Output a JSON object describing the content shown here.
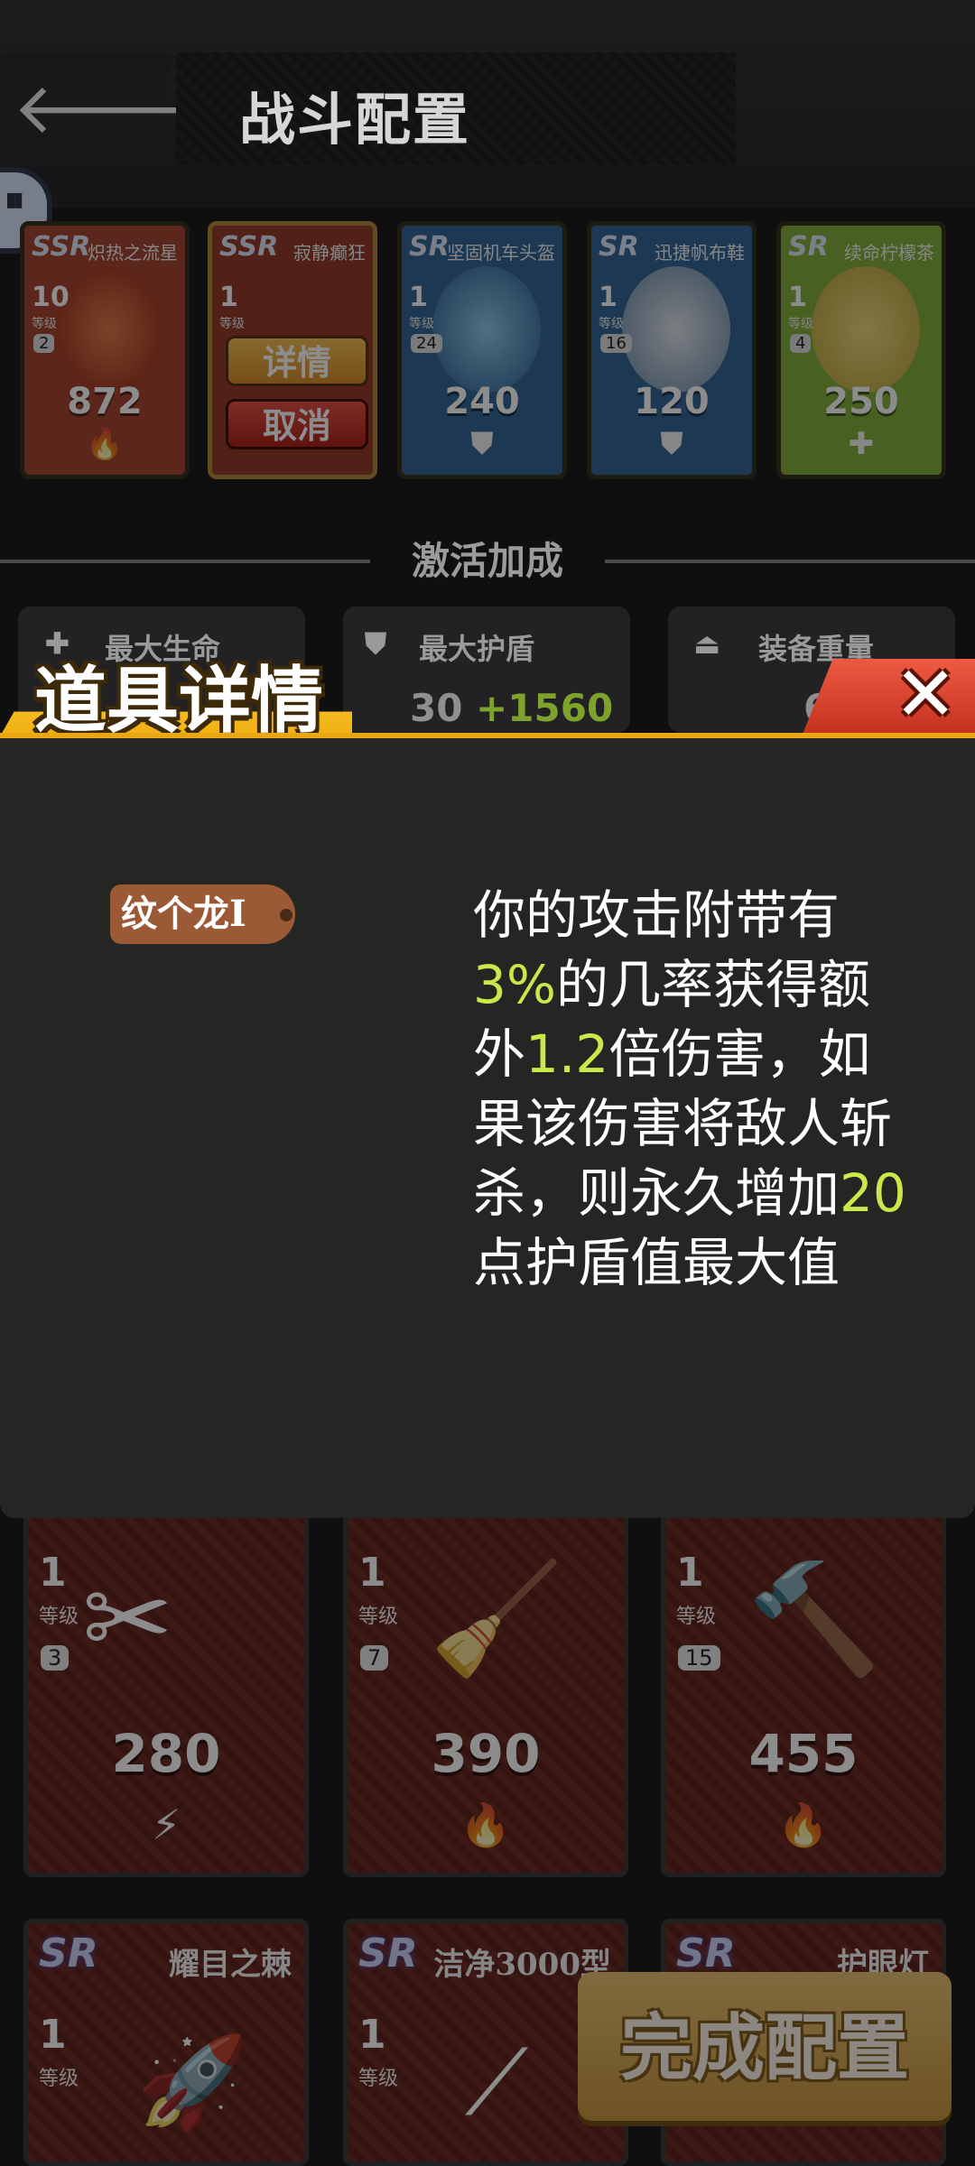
{
  "header": {
    "title": "战斗配置",
    "back_icon": "arrow-left-icon",
    "chat_icon": "chat-bubble-icon"
  },
  "equipped_cards": [
    {
      "rarity": "SSR",
      "name": "炽热之流星",
      "level": "10",
      "level_caption": "等级",
      "cost": "2",
      "power": "872",
      "badge_icon": "flame-icon",
      "color": "#c2432a"
    },
    {
      "rarity": "SSR",
      "name": "寂静癫狂",
      "level": "1",
      "level_caption": "等级",
      "cost": "",
      "power": "",
      "badge_icon": "",
      "color": "#b23a24"
    },
    {
      "rarity": "SR",
      "name": "坚固机车头盔",
      "level": "1",
      "level_caption": "等级",
      "cost": "24",
      "power": "240",
      "badge_icon": "shield-icon",
      "color": "#2a6fb0"
    },
    {
      "rarity": "SR",
      "name": "迅捷帆布鞋",
      "level": "1",
      "level_caption": "等级",
      "cost": "16",
      "power": "120",
      "badge_icon": "shield-icon",
      "color": "#2a6fb0"
    },
    {
      "rarity": "SR",
      "name": "续命柠檬茶",
      "level": "1",
      "level_caption": "等级",
      "cost": "4",
      "power": "250",
      "badge_icon": "plus-icon",
      "color": "#7fb526"
    }
  ],
  "card_actions": {
    "detail_label": "详情",
    "cancel_label": "取消"
  },
  "bonus": {
    "title": "激活加成",
    "stats": [
      {
        "label": "最大生命",
        "value": "",
        "plus": "",
        "icon": "plus-icon"
      },
      {
        "label": "最大护盾",
        "value": "30",
        "plus": "+1560",
        "icon": "shield-icon"
      },
      {
        "label": "装备重量",
        "value": "6",
        "plus": "",
        "icon": "weight-icon"
      }
    ]
  },
  "modal": {
    "title": "道具详情",
    "close_icon": "close-icon",
    "tag": "纹个龙I",
    "description": [
      {
        "text": "你的攻击附带有",
        "hl": false
      },
      {
        "text": "3%",
        "hl": true
      },
      {
        "text": "的几率获得额外",
        "hl": false
      },
      {
        "text": "1.2",
        "hl": true
      },
      {
        "text": "倍伤害，如果该伤害将敌人斩杀，则永久增加",
        "hl": false
      },
      {
        "text": "20",
        "hl": true
      },
      {
        "text": "点护盾值最大值",
        "hl": false
      }
    ],
    "highlight_color": "#c9e84a"
  },
  "inventory_row1": [
    {
      "level": "1",
      "level_caption": "等级",
      "cost": "3",
      "power": "280",
      "badge_icon": "lightning-icon",
      "art_icon": "scissors-icon"
    },
    {
      "level": "1",
      "level_caption": "等级",
      "cost": "7",
      "power": "390",
      "badge_icon": "flame-icon",
      "art_icon": "broom-icon"
    },
    {
      "level": "1",
      "level_caption": "等级",
      "cost": "15",
      "power": "455",
      "badge_icon": "flame-icon",
      "art_icon": "hammer-icon"
    }
  ],
  "inventory_row2": [
    {
      "rarity": "SR",
      "name": "耀目之棘",
      "level": "1",
      "level_caption": "等级",
      "art_icon": "rocket-icon"
    },
    {
      "rarity": "SR",
      "name": "洁净3000型",
      "level": "1",
      "level_caption": "等级",
      "art_icon": "mop-icon"
    },
    {
      "rarity": "SR",
      "name": "护眼灯",
      "level": "",
      "level_caption": "",
      "art_icon": ""
    }
  ],
  "finish_button": "完成配置"
}
